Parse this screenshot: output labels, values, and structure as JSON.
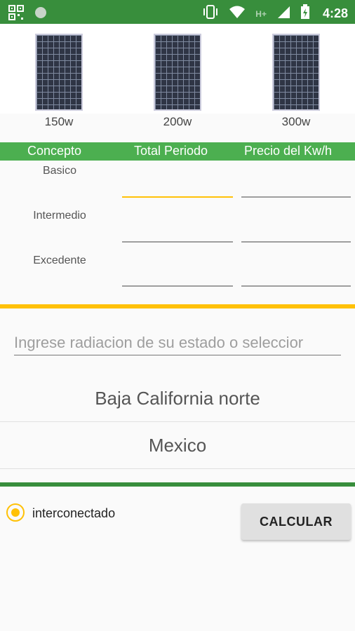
{
  "status_bar": {
    "time": "4:28",
    "network_label": "H+",
    "icons": [
      "qr-code-icon",
      "circle-icon",
      "vibrate-icon",
      "wifi-icon",
      "signal-icon",
      "battery-icon"
    ],
    "color": "#388e3c"
  },
  "panels": [
    {
      "label": "150w"
    },
    {
      "label": "200w"
    },
    {
      "label": "300w"
    }
  ],
  "table": {
    "headers": [
      "Concepto",
      "Total Periodo",
      "Precio del Kw/h"
    ],
    "rows": [
      {
        "label": "Basico",
        "total": "",
        "precio": ""
      },
      {
        "label": "Intermedio",
        "total": "",
        "precio": ""
      },
      {
        "label": "Excedente",
        "total": "",
        "precio": ""
      }
    ]
  },
  "radiation_input": {
    "value": "",
    "placeholder": "Ingrese radiacion de su estado o seleccior"
  },
  "spinners": {
    "state": "Baja California norte",
    "country": "Mexico"
  },
  "radio": {
    "label": "interconectado",
    "checked": true
  },
  "calculate_button": {
    "label": "CALCULAR"
  },
  "colors": {
    "accent_yellow": "#ffc107",
    "header_green": "#4caf50",
    "dark_green": "#388e3c"
  }
}
